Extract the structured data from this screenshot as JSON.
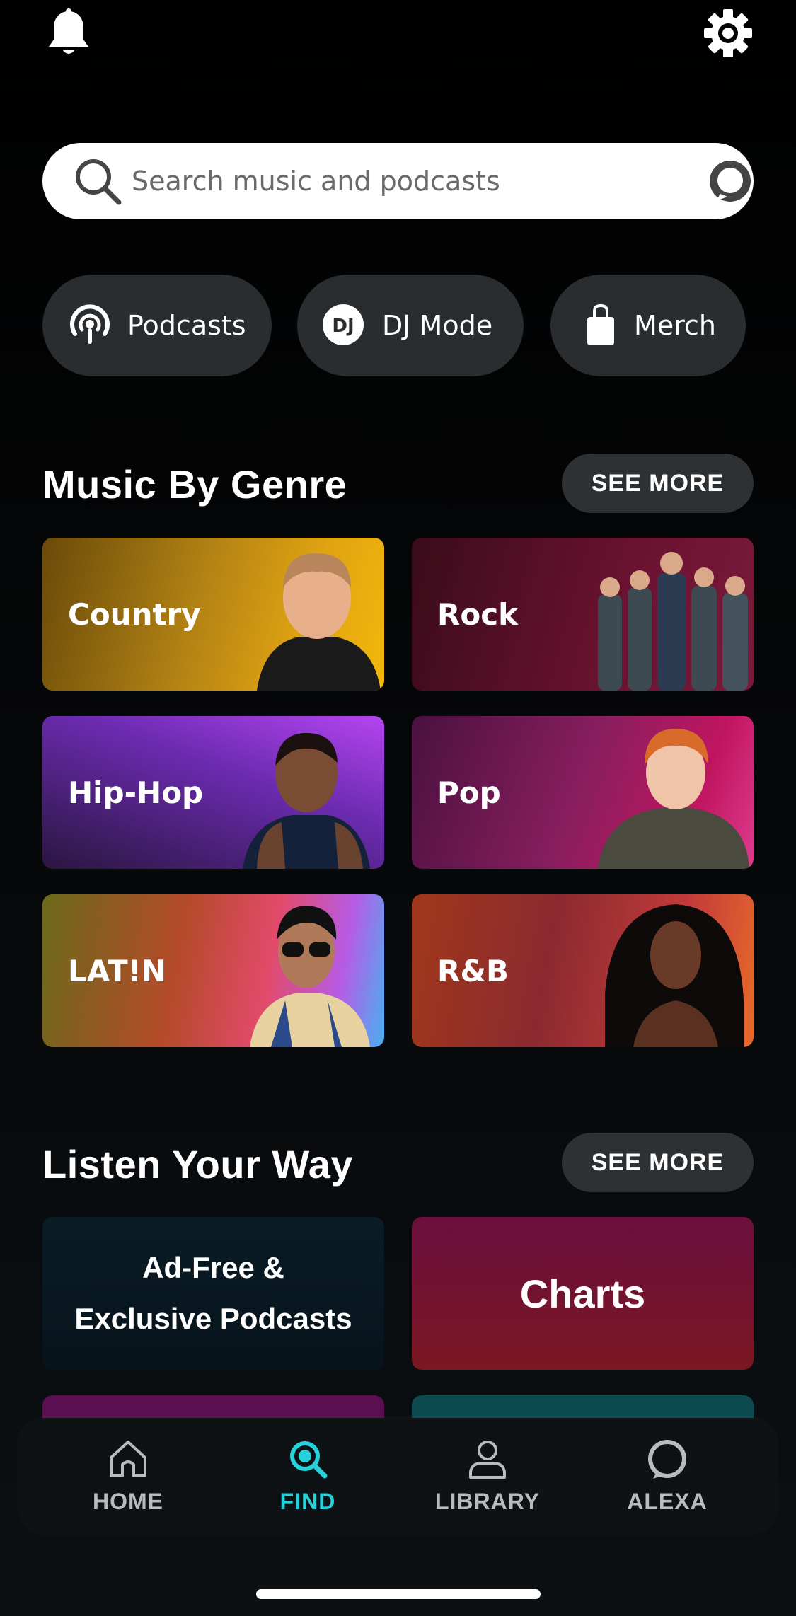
{
  "top_bar": {
    "bell_icon": "bell-icon",
    "settings_icon": "gear-icon"
  },
  "search": {
    "placeholder": "Search music and podcasts",
    "value": "",
    "left_icon": "search-icon",
    "right_icon": "alexa-icon"
  },
  "chips": [
    {
      "label": "Podcasts",
      "icon": "podcast-icon"
    },
    {
      "label": "DJ Mode",
      "icon": "dj-icon",
      "icon_text": "DJ"
    },
    {
      "label": "Merch",
      "icon": "shopping-bag-icon"
    }
  ],
  "genre_section": {
    "title": "Music By Genre",
    "see_more": "SEE MORE",
    "tiles": [
      {
        "label": "Country",
        "color": "#e0a311"
      },
      {
        "label": "Rock",
        "color": "#6a1230"
      },
      {
        "label": "Hip-Hop",
        "color": "#6b2bb0"
      },
      {
        "label": "Pop",
        "color": "#c01560"
      },
      {
        "label": "LAT!N",
        "color": "#e24a6a"
      },
      {
        "label": "R&B",
        "color": "#c23a3a"
      }
    ]
  },
  "listen_section": {
    "title": "Listen Your Way",
    "see_more": "SEE MORE",
    "tiles": [
      {
        "label": "Ad-Free & Exclusive Podcasts",
        "line1": "Ad-Free &",
        "line2": "Exclusive Podcasts"
      },
      {
        "label": "Charts"
      }
    ]
  },
  "bottom_nav": {
    "items": [
      {
        "label": "HOME",
        "icon": "home-icon",
        "active": false
      },
      {
        "label": "FIND",
        "icon": "search-icon",
        "active": true
      },
      {
        "label": "LIBRARY",
        "icon": "person-icon",
        "active": false
      },
      {
        "label": "ALEXA",
        "icon": "alexa-icon",
        "active": false
      }
    ],
    "active_color": "#25d1da",
    "inactive_color": "#b7bcc0"
  }
}
